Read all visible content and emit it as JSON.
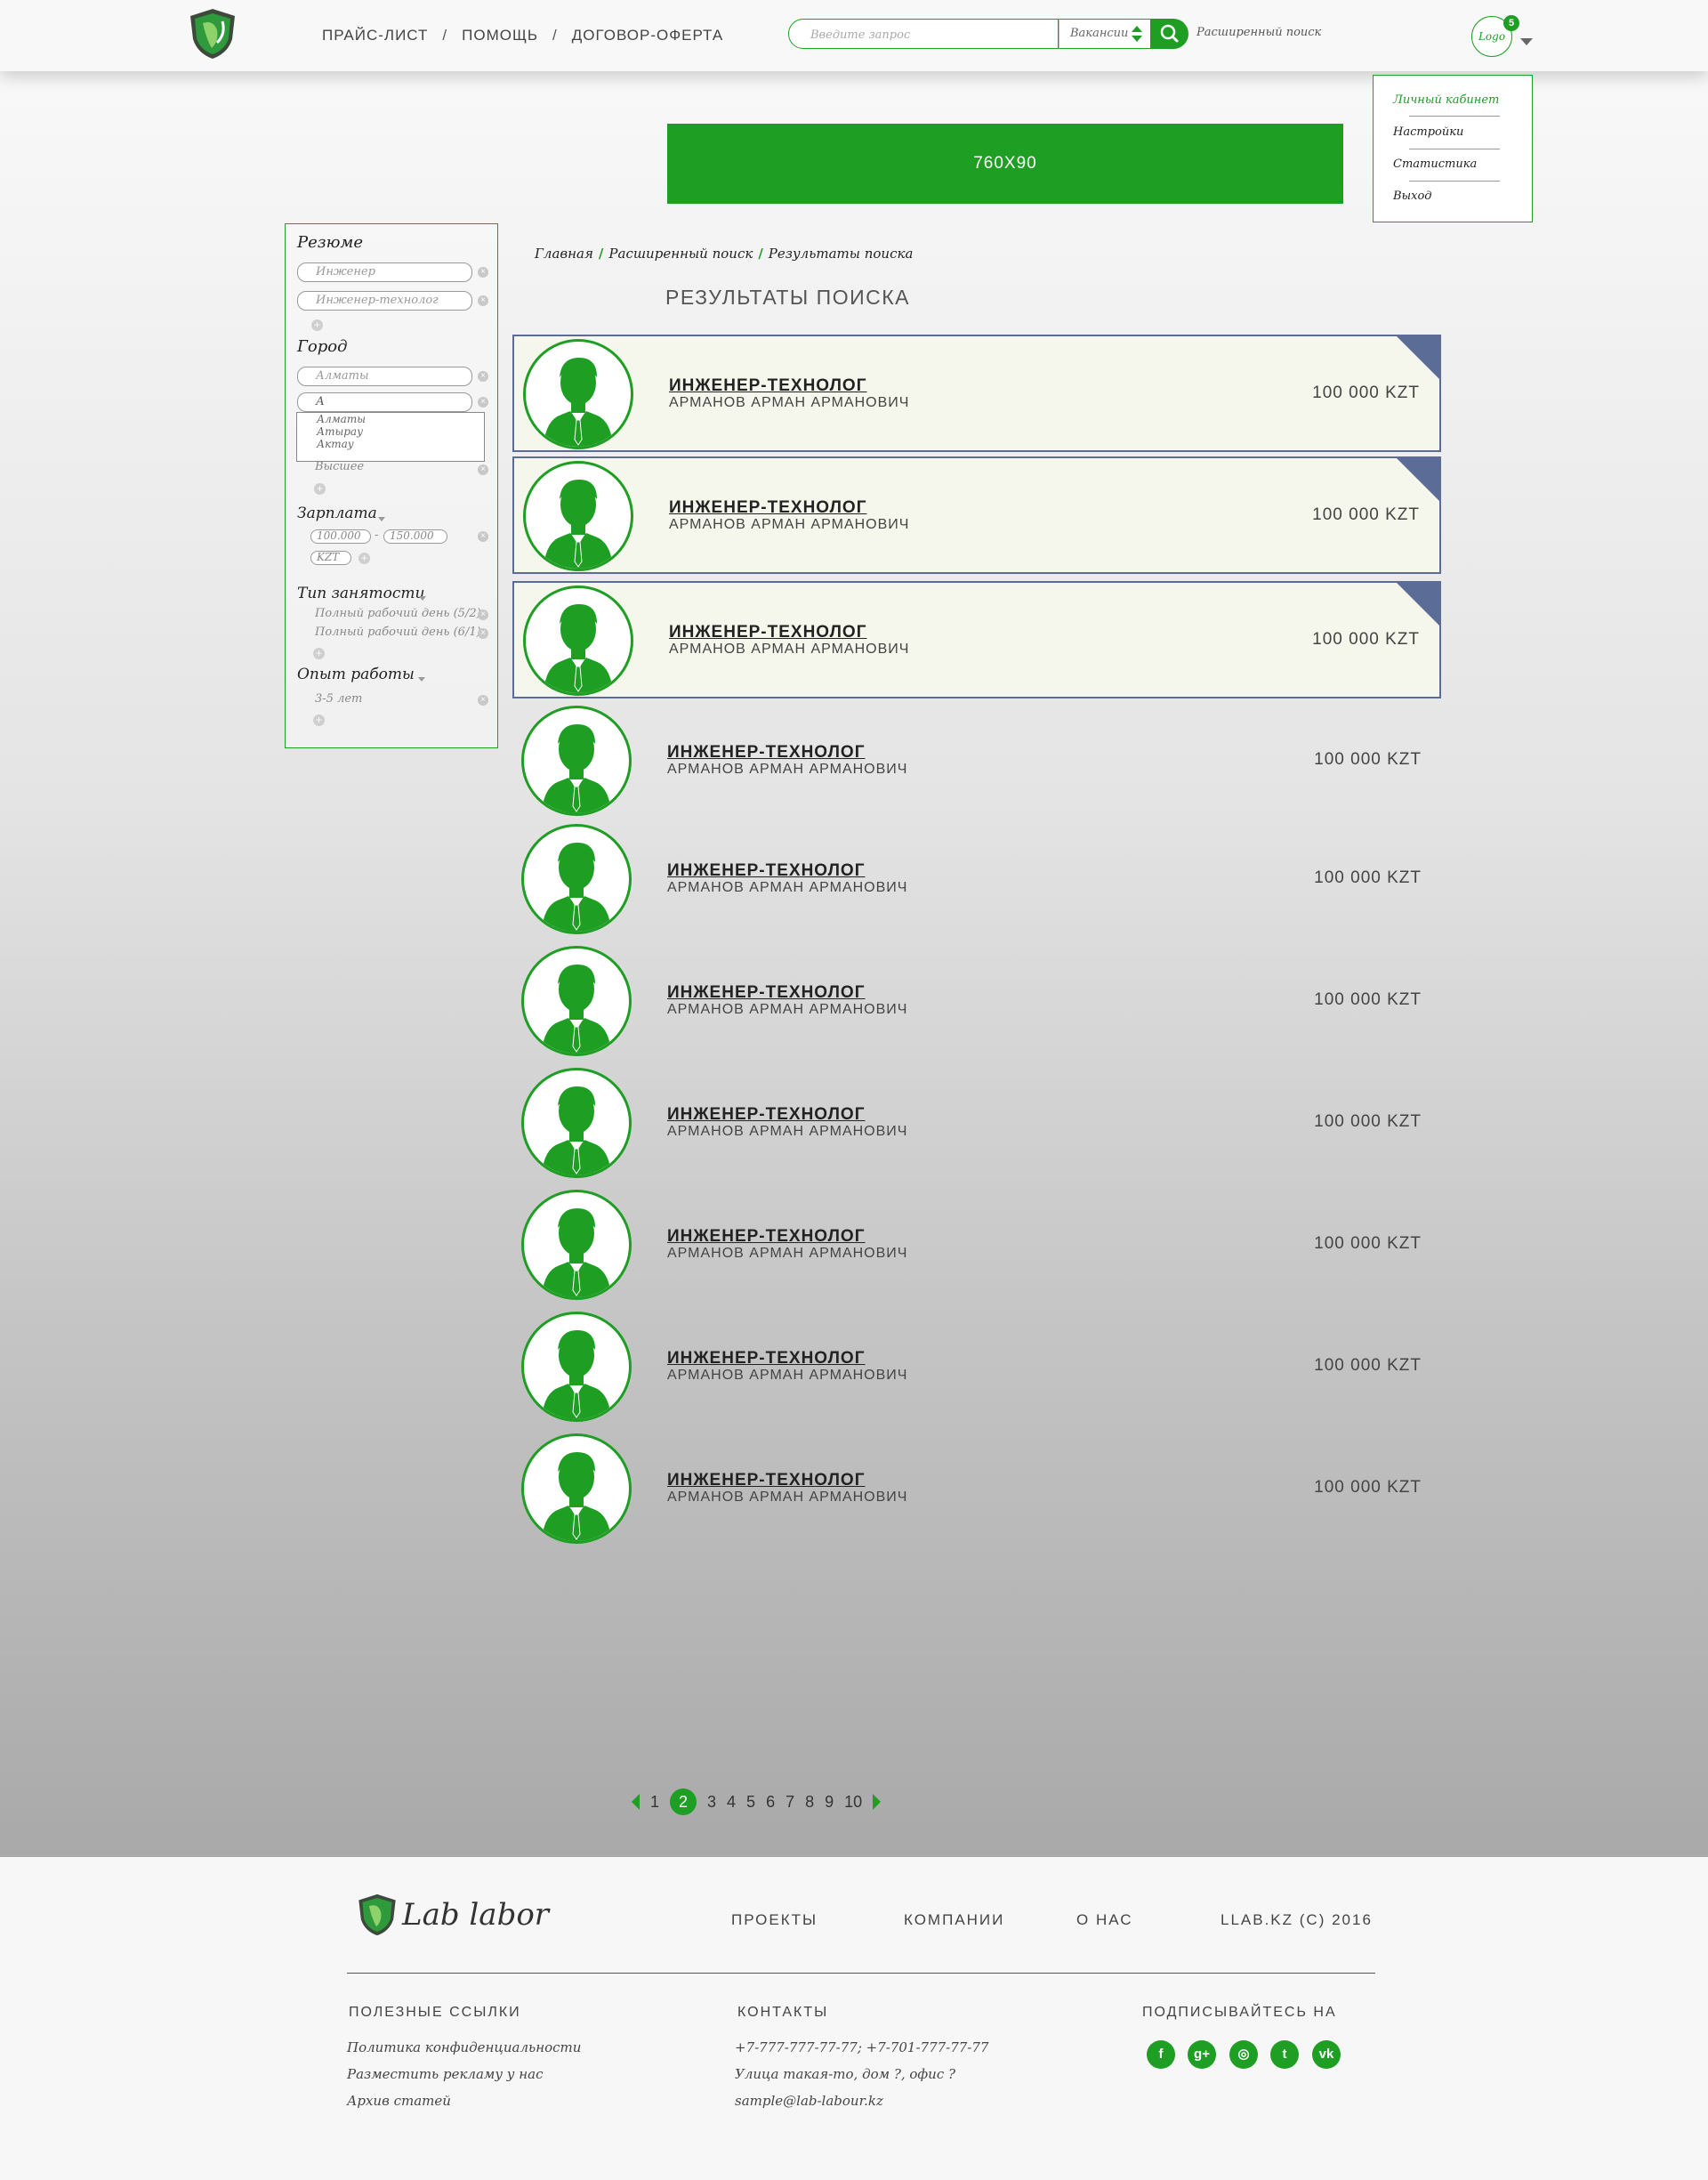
{
  "header": {
    "nav": [
      {
        "label": "ПРАЙС-ЛИСТ"
      },
      {
        "label": "ПОМОЩЬ"
      },
      {
        "label": "ДОГОВОР-ОФЕРТА"
      }
    ],
    "nav_separator": "/",
    "search_placeholder": "Введите запрос",
    "search_type": "Вакансии",
    "advanced_search": "Расширенный поиск",
    "avatar_label": "Logo",
    "notifications": "5"
  },
  "user_menu": {
    "items": [
      {
        "label": "Личный кабинет",
        "active": true
      },
      {
        "label": "Настройки"
      },
      {
        "label": "Статистика"
      },
      {
        "label": "Выход"
      }
    ]
  },
  "banner": {
    "label": "760X90"
  },
  "filter": {
    "resume_title": "Резюме",
    "resume_values": [
      "Инженер",
      "Инженер-технолог"
    ],
    "city_title": "Город",
    "city_value": "Алматы",
    "city_input": "А",
    "city_suggestions": [
      "Алматы",
      "Атырау",
      "Актау"
    ],
    "education_value": "Высшее",
    "salary_title": "Зарплата",
    "salary_from": "100.000",
    "salary_sep": "-",
    "salary_to": "150.000",
    "currency": "KZT",
    "employment_title": "Тип занятости",
    "employment_values": [
      "Полный рабочий день (5/2)",
      "Полный рабочий день (6/1)"
    ],
    "experience_title": "Опыт работы",
    "experience_value": "3-5 лет"
  },
  "breadcrumbs": [
    "Главная",
    "Расширенный поиск",
    "Результаты поиска"
  ],
  "breadcrumb_separator": "/",
  "results_title": "РЕЗУЛЬТАТЫ ПОИСКА",
  "results": [
    {
      "title": "ИНЖЕНЕР-ТЕХНОЛОГ",
      "name": "АРМАНОВ АРМАН АРМАНОВИЧ",
      "salary": "100 000 KZT",
      "highlighted": true
    },
    {
      "title": "ИНЖЕНЕР-ТЕХНОЛОГ",
      "name": "АРМАНОВ АРМАН АРМАНОВИЧ",
      "salary": "100 000 KZT",
      "highlighted": true
    },
    {
      "title": "ИНЖЕНЕР-ТЕХНОЛОГ",
      "name": "АРМАНОВ АРМАН АРМАНОВИЧ",
      "salary": "100 000 KZT",
      "highlighted": true
    },
    {
      "title": "ИНЖЕНЕР-ТЕХНОЛОГ",
      "name": "АРМАНОВ АРМАН АРМАНОВИЧ",
      "salary": "100 000 KZT",
      "highlighted": false
    },
    {
      "title": "ИНЖЕНЕР-ТЕХНОЛОГ",
      "name": "АРМАНОВ АРМАН АРМАНОВИЧ",
      "salary": "100 000 KZT",
      "highlighted": false
    },
    {
      "title": "ИНЖЕНЕР-ТЕХНОЛОГ",
      "name": "АРМАНОВ АРМАН АРМАНОВИЧ",
      "salary": "100 000 KZT",
      "highlighted": false
    },
    {
      "title": "ИНЖЕНЕР-ТЕХНОЛОГ",
      "name": "АРМАНОВ АРМАН АРМАНОВИЧ",
      "salary": "100 000 KZT",
      "highlighted": false
    },
    {
      "title": "ИНЖЕНЕР-ТЕХНОЛОГ",
      "name": "АРМАНОВ АРМАН АРМАНОВИЧ",
      "salary": "100 000 KZT",
      "highlighted": false
    },
    {
      "title": "ИНЖЕНЕР-ТЕХНОЛОГ",
      "name": "АРМАНОВ АРМАН АРМАНОВИЧ",
      "salary": "100 000 KZT",
      "highlighted": false
    },
    {
      "title": "ИНЖЕНЕР-ТЕХНОЛОГ",
      "name": "АРМАНОВ АРМАН АРМАНОВИЧ",
      "salary": "100 000 KZT",
      "highlighted": false
    }
  ],
  "pagination": {
    "pages": [
      "1",
      "2",
      "3",
      "4",
      "5",
      "6",
      "7",
      "8",
      "9",
      "10"
    ],
    "current": "2"
  },
  "footer": {
    "logo_text": "Lab labor",
    "nav": [
      "ПРОЕКТЫ",
      "КОМПАНИИ",
      "О НАС"
    ],
    "copyright": "LLAB.KZ (C) 2016",
    "links_title": "ПОЛЕЗНЫЕ ССЫЛКИ",
    "links": [
      "Политика конфиденциальности",
      "Разместить рекламу у нас",
      "Архив статей"
    ],
    "contacts_title": "КОНТАКТЫ",
    "contacts": [
      "+7-777-777-77-77; +7-701-777-77-77",
      "Улица такая-то, дом ?, офис ?",
      "sample@lab-labour.kz"
    ],
    "social_title": "ПОДПИСЫВАЙТЕСЬ НА",
    "social": [
      {
        "icon": "facebook-icon",
        "glyph": "f"
      },
      {
        "icon": "google-plus-icon",
        "glyph": "g+"
      },
      {
        "icon": "instagram-icon",
        "glyph": "◎"
      },
      {
        "icon": "twitter-icon",
        "glyph": "t"
      },
      {
        "icon": "vk-icon",
        "glyph": "vk"
      }
    ]
  },
  "colors": {
    "accent": "#1e9e23",
    "highlight_border": "#5b6c96",
    "highlight_bg": "#f5f6ec"
  }
}
